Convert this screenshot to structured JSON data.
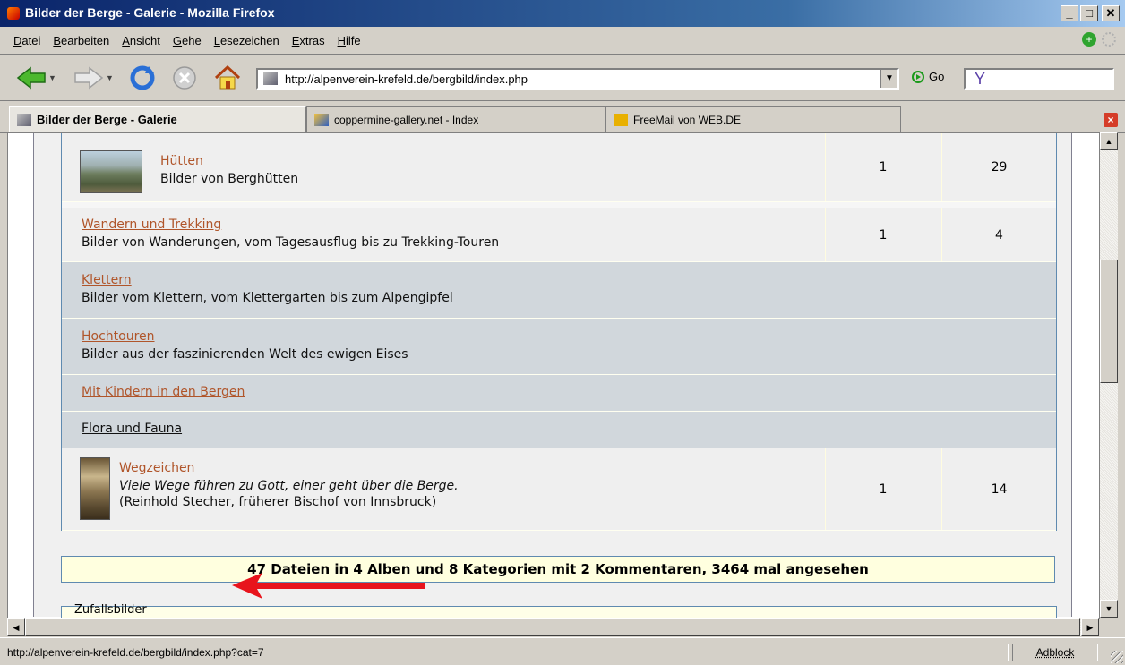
{
  "window": {
    "title": "Bilder der Berge - Galerie - Mozilla Firefox"
  },
  "menu": {
    "items": [
      "Datei",
      "Bearbeiten",
      "Ansicht",
      "Gehe",
      "Lesezeichen",
      "Extras",
      "Hilfe"
    ]
  },
  "nav": {
    "url": "http://alpenverein-krefeld.de/bergbild/index.php",
    "go_label": "Go",
    "search_engine": "Y"
  },
  "tabs": [
    {
      "label": "Bilder der Berge - Galerie",
      "active": true
    },
    {
      "label": "coppermine-gallery.net - Index",
      "active": false
    },
    {
      "label": "FreeMail von WEB.DE",
      "active": false
    }
  ],
  "gallery": {
    "rows": [
      {
        "name": "Hütten",
        "desc": "Bilder von Berghütten",
        "albums": "1",
        "files": "29",
        "type": "album"
      },
      {
        "name": "Wandern und Trekking",
        "desc": "Bilder von Wanderungen, vom Tagesausflug bis zu Trekking-Touren",
        "albums": "1",
        "files": "4",
        "type": "album"
      },
      {
        "name": "Klettern",
        "desc": "Bilder vom Klettern, vom Klettergarten bis zum Alpengipfel",
        "type": "category"
      },
      {
        "name": "Hochtouren",
        "desc": "Bilder aus der faszinierenden Welt des ewigen Eises",
        "type": "category"
      },
      {
        "name": "Mit Kindern in den Bergen",
        "type": "category"
      },
      {
        "name": "Flora und Fauna",
        "type": "category"
      },
      {
        "name": "Wegzeichen",
        "desc_line1": "Viele Wege führen zu Gott, einer geht über die Berge.",
        "desc_line2": "(Reinhold Stecher, früherer Bischof von Innsbruck)",
        "albums": "1",
        "files": "14",
        "type": "album"
      }
    ],
    "summary": "47 Dateien in 4 Alben und 8 Kategorien mit 2 Kommentaren, 3464 mal angesehen",
    "next_section_label": "Zufallsbilder"
  },
  "status": {
    "message": "http://alpenverein-krefeld.de/bergbild/index.php?cat=7",
    "adblock": "Adblock"
  },
  "colors": {
    "link": "#b0552a",
    "category_bg": "#d1d7dc",
    "album_bg": "#efefef",
    "footer_bg": "#ffffdf",
    "arrow": "#e8141c"
  }
}
